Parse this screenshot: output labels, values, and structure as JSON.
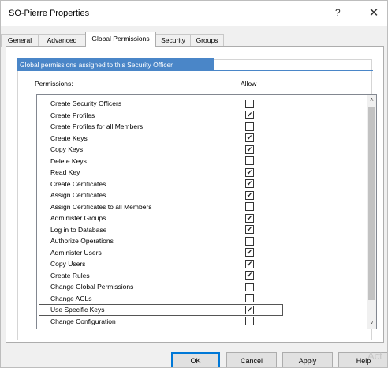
{
  "window": {
    "title": "SO-Pierre Properties",
    "help_glyph": "?",
    "close_glyph": "✕"
  },
  "tabs": [
    {
      "label": "General",
      "active": false
    },
    {
      "label": "Advanced",
      "active": false
    },
    {
      "label": "Global Permissions",
      "active": true
    },
    {
      "label": "Security",
      "active": false
    },
    {
      "label": "Groups",
      "active": false
    }
  ],
  "group": {
    "header": "Global permissions assigned to this Security Officer",
    "col_permissions": "Permissions:",
    "col_allow": "Allow"
  },
  "permissions": [
    {
      "name": "Create Security Officers",
      "allow": false
    },
    {
      "name": "Create Profiles",
      "allow": true
    },
    {
      "name": "Create Profiles for all Members",
      "allow": false
    },
    {
      "name": "Create Keys",
      "allow": true
    },
    {
      "name": "Copy Keys",
      "allow": true
    },
    {
      "name": "Delete Keys",
      "allow": false
    },
    {
      "name": "Read Key",
      "allow": true
    },
    {
      "name": "Create Certificates",
      "allow": true
    },
    {
      "name": "Assign Certificates",
      "allow": true
    },
    {
      "name": "Assign Certificates to all Members",
      "allow": false
    },
    {
      "name": "Administer Groups",
      "allow": true
    },
    {
      "name": "Log in to Database",
      "allow": true
    },
    {
      "name": "Authorize Operations",
      "allow": false
    },
    {
      "name": "Administer Users",
      "allow": true
    },
    {
      "name": "Copy Users",
      "allow": true
    },
    {
      "name": "Create Rules",
      "allow": true
    },
    {
      "name": "Change Global Permissions",
      "allow": false
    },
    {
      "name": "Change ACLs",
      "allow": false
    },
    {
      "name": "Use Specific Keys",
      "allow": true,
      "selected": true
    },
    {
      "name": "Change Configuration",
      "allow": false
    }
  ],
  "scrollbar": {
    "up_glyph": "˄",
    "down_glyph": "˅"
  },
  "buttons": {
    "ok": "OK",
    "cancel": "Cancel",
    "apply": "Apply",
    "help": "Help"
  },
  "watermark": "Act"
}
